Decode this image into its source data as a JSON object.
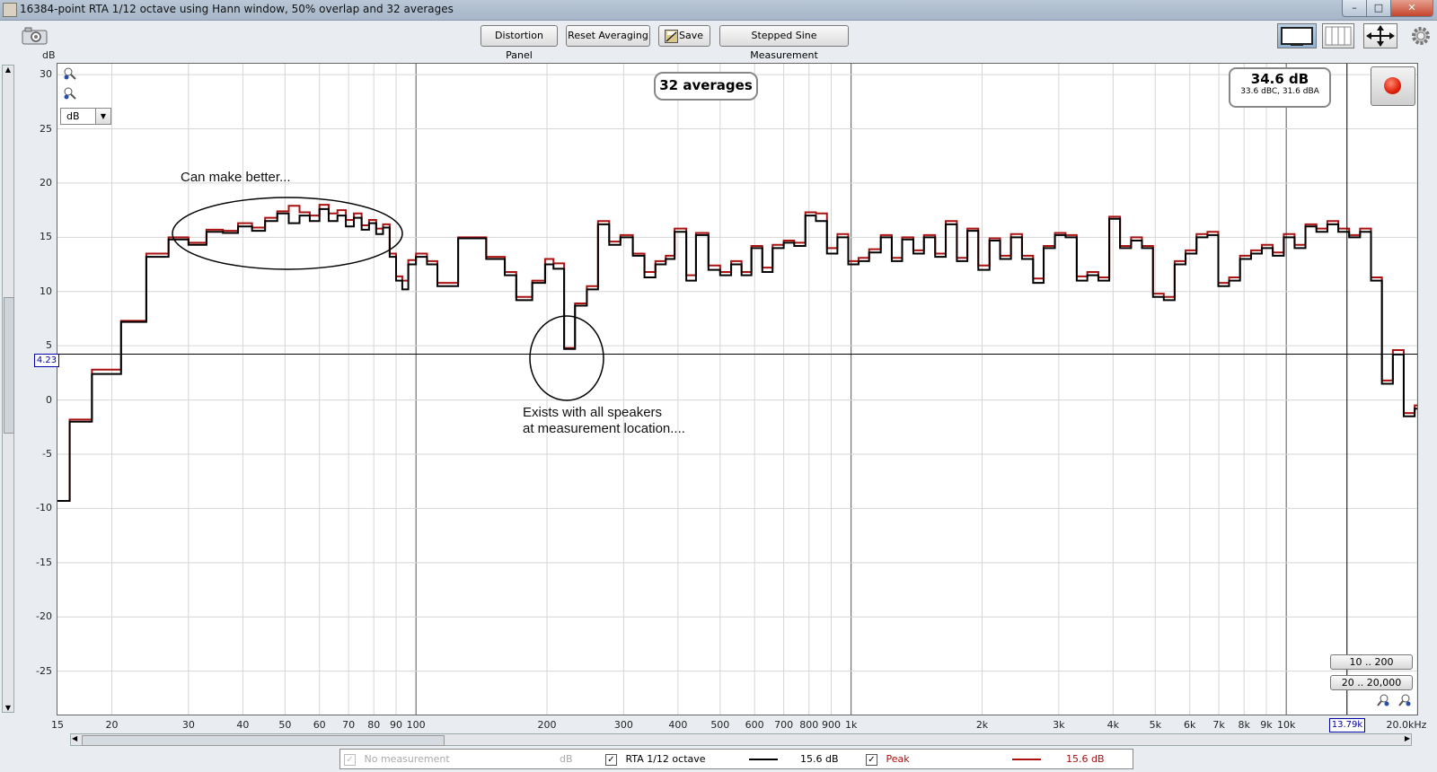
{
  "window": {
    "title": "16384-point RTA 1/12 octave using Hann window, 50% overlap and 32 averages",
    "minimize": "–",
    "maximize": "□",
    "close": "✕"
  },
  "toolbar": {
    "distortion_label": "Distortion Panel",
    "reset_label": "Reset Averaging",
    "save_label": "Save",
    "stepped_label": "Stepped Sine Measurement"
  },
  "plot": {
    "y_unit": "dB",
    "x_unit": "Hz",
    "y_ticks": [
      "30",
      "25",
      "20",
      "15",
      "10",
      "5",
      "0",
      "-5",
      "-10",
      "-15",
      "-20",
      "-25"
    ],
    "y_values": [
      30,
      25,
      20,
      15,
      10,
      5,
      0,
      -5,
      -10,
      -15,
      -20,
      -25
    ],
    "x_ticks": [
      {
        "label": "15",
        "f": 15
      },
      {
        "label": "20",
        "f": 20
      },
      {
        "label": "30",
        "f": 30
      },
      {
        "label": "40",
        "f": 40
      },
      {
        "label": "50",
        "f": 50
      },
      {
        "label": "60",
        "f": 60
      },
      {
        "label": "70",
        "f": 70
      },
      {
        "label": "80",
        "f": 80
      },
      {
        "label": "90",
        "f": 90
      },
      {
        "label": "100",
        "f": 100
      },
      {
        "label": "200",
        "f": 200
      },
      {
        "label": "300",
        "f": 300
      },
      {
        "label": "400",
        "f": 400
      },
      {
        "label": "500",
        "f": 500
      },
      {
        "label": "600",
        "f": 600
      },
      {
        "label": "700",
        "f": 700
      },
      {
        "label": "800",
        "f": 800
      },
      {
        "label": "900",
        "f": 900
      },
      {
        "label": "1k",
        "f": 1000
      },
      {
        "label": "2k",
        "f": 2000
      },
      {
        "label": "3k",
        "f": 3000
      },
      {
        "label": "4k",
        "f": 4000
      },
      {
        "label": "5k",
        "f": 5000
      },
      {
        "label": "6k",
        "f": 6000
      },
      {
        "label": "7k",
        "f": 7000
      },
      {
        "label": "8k",
        "f": 8000
      },
      {
        "label": "9k",
        "f": 9000
      },
      {
        "label": "10k",
        "f": 10000
      },
      {
        "label": "20.0kHz",
        "f": 20000
      }
    ],
    "cursor_y_label": "4.23",
    "cursor_x_label": "13.79k",
    "cursor_y_value": 4.23,
    "cursor_x_value": 13790,
    "unit_select": "dB",
    "averages_badge": "32 averages",
    "spl_main": "34.6 dB",
    "spl_sub": "33.6 dBC, 31.6 dBA",
    "range_btn_1": "10 .. 200",
    "range_btn_2": "20 .. 20,000",
    "annotation_1": "Can make better...",
    "annotation_2_line1": "Exists with all speakers",
    "annotation_2_line2": "at measurement location....",
    "colors": {
      "rta": "#000000",
      "peak": "#aa1111",
      "grid_major": "#9a9a9a",
      "grid_minor": "#d6d6d6",
      "cursor": "#000000"
    }
  },
  "chart_data": {
    "type": "line",
    "xlabel": "Hz",
    "ylabel": "dB",
    "x_scale": "log",
    "xlim": [
      15,
      20000
    ],
    "ylim": [
      -29,
      31
    ],
    "grid": true,
    "series": [
      {
        "name": "RTA 1/12 octave",
        "color": "#000000",
        "points": [
          [
            15,
            -9.3
          ],
          [
            16,
            -2
          ],
          [
            18,
            2.4
          ],
          [
            21,
            7.2
          ],
          [
            24,
            13.2
          ],
          [
            27,
            14.8
          ],
          [
            30,
            14.3
          ],
          [
            33,
            15.5
          ],
          [
            36,
            15.4
          ],
          [
            39,
            16.0
          ],
          [
            42,
            15.6
          ],
          [
            45,
            16.5
          ],
          [
            48,
            17.2
          ],
          [
            51,
            16.3
          ],
          [
            54,
            17.0
          ],
          [
            57,
            16.5
          ],
          [
            60,
            17.6
          ],
          [
            63,
            16.5
          ],
          [
            66,
            17.0
          ],
          [
            69,
            16.0
          ],
          [
            72,
            16.8
          ],
          [
            75,
            15.7
          ],
          [
            78,
            16.3
          ],
          [
            81,
            15.3
          ],
          [
            84,
            15.9
          ],
          [
            87,
            13.2
          ],
          [
            90,
            11.0
          ],
          [
            93,
            10.2
          ],
          [
            96,
            12.5
          ],
          [
            100,
            13.2
          ],
          [
            106,
            12.5
          ],
          [
            112,
            10.5
          ],
          [
            125,
            14.9
          ],
          [
            145,
            13.0
          ],
          [
            160,
            11.5
          ],
          [
            170,
            9.2
          ],
          [
            185,
            10.8
          ],
          [
            198,
            12.5
          ],
          [
            207,
            12.1
          ],
          [
            219,
            4.7
          ],
          [
            232,
            8.7
          ],
          [
            247,
            10.2
          ],
          [
            262,
            16.2
          ],
          [
            278,
            14.3
          ],
          [
            295,
            15.0
          ],
          [
            315,
            13.3
          ],
          [
            335,
            11.3
          ],
          [
            355,
            12.5
          ],
          [
            375,
            13.0
          ],
          [
            393,
            15.5
          ],
          [
            418,
            11.0
          ],
          [
            440,
            15.2
          ],
          [
            470,
            12.0
          ],
          [
            500,
            11.5
          ],
          [
            530,
            12.5
          ],
          [
            560,
            11.5
          ],
          [
            590,
            14.0
          ],
          [
            625,
            11.8
          ],
          [
            660,
            14.0
          ],
          [
            700,
            14.5
          ],
          [
            740,
            14.2
          ],
          [
            785,
            17.0
          ],
          [
            830,
            16.5
          ],
          [
            880,
            13.5
          ],
          [
            930,
            15.0
          ],
          [
            985,
            12.5
          ],
          [
            1040,
            12.8
          ],
          [
            1100,
            13.6
          ],
          [
            1170,
            15.0
          ],
          [
            1240,
            12.8
          ],
          [
            1310,
            14.8
          ],
          [
            1390,
            13.5
          ],
          [
            1470,
            15.0
          ],
          [
            1560,
            13.2
          ],
          [
            1650,
            16.2
          ],
          [
            1750,
            12.8
          ],
          [
            1850,
            15.6
          ],
          [
            1960,
            12.0
          ],
          [
            2080,
            14.7
          ],
          [
            2200,
            13.0
          ],
          [
            2330,
            15.0
          ],
          [
            2470,
            13.0
          ],
          [
            2620,
            10.8
          ],
          [
            2770,
            14.0
          ],
          [
            2940,
            15.2
          ],
          [
            3110,
            15.0
          ],
          [
            3300,
            11.0
          ],
          [
            3490,
            11.5
          ],
          [
            3700,
            11.0
          ],
          [
            3920,
            16.7
          ],
          [
            4150,
            14.0
          ],
          [
            4400,
            14.7
          ],
          [
            4660,
            14.0
          ],
          [
            4940,
            9.5
          ],
          [
            5230,
            9.2
          ],
          [
            5540,
            12.5
          ],
          [
            5870,
            13.5
          ],
          [
            6220,
            15.0
          ],
          [
            6590,
            15.2
          ],
          [
            6980,
            10.5
          ],
          [
            7390,
            11.0
          ],
          [
            7830,
            13.0
          ],
          [
            8300,
            13.5
          ],
          [
            8790,
            14.0
          ],
          [
            9310,
            13.3
          ],
          [
            9870,
            15.0
          ],
          [
            10450,
            14.0
          ],
          [
            11070,
            16.0
          ],
          [
            11730,
            15.5
          ],
          [
            12430,
            16.2
          ],
          [
            13170,
            15.5
          ],
          [
            13950,
            15.0
          ],
          [
            14780,
            15.5
          ],
          [
            15660,
            11.0
          ],
          [
            16590,
            1.5
          ],
          [
            17580,
            4.2
          ],
          [
            18620,
            -1.5
          ],
          [
            19730,
            -0.8
          ],
          [
            20900,
            -5.4
          ]
        ]
      },
      {
        "name": "Peak",
        "color": "#aa1111",
        "points": [
          [
            15,
            -9.3
          ],
          [
            16,
            -1.8
          ],
          [
            18,
            2.8
          ],
          [
            21,
            7.3
          ],
          [
            24,
            13.5
          ],
          [
            27,
            15.0
          ],
          [
            30,
            14.5
          ],
          [
            33,
            15.7
          ],
          [
            36,
            15.6
          ],
          [
            39,
            16.3
          ],
          [
            42,
            15.9
          ],
          [
            45,
            16.8
          ],
          [
            48,
            17.4
          ],
          [
            51,
            17.9
          ],
          [
            54,
            17.3
          ],
          [
            57,
            17.0
          ],
          [
            60,
            18.0
          ],
          [
            63,
            17.2
          ],
          [
            66,
            17.5
          ],
          [
            69,
            16.6
          ],
          [
            72,
            17.2
          ],
          [
            75,
            16.1
          ],
          [
            78,
            16.6
          ],
          [
            81,
            15.8
          ],
          [
            84,
            16.2
          ],
          [
            87,
            13.5
          ],
          [
            90,
            11.4
          ],
          [
            93,
            11.0
          ],
          [
            96,
            12.9
          ],
          [
            100,
            13.5
          ],
          [
            106,
            12.8
          ],
          [
            112,
            10.8
          ],
          [
            125,
            15.0
          ],
          [
            145,
            13.2
          ],
          [
            160,
            11.8
          ],
          [
            170,
            9.5
          ],
          [
            185,
            11.0
          ],
          [
            198,
            13.0
          ],
          [
            207,
            12.6
          ],
          [
            219,
            4.8
          ],
          [
            232,
            8.9
          ],
          [
            247,
            10.5
          ],
          [
            262,
            16.5
          ],
          [
            278,
            14.6
          ],
          [
            295,
            15.2
          ],
          [
            315,
            13.5
          ],
          [
            335,
            11.8
          ],
          [
            355,
            12.8
          ],
          [
            375,
            13.3
          ],
          [
            393,
            15.8
          ],
          [
            418,
            11.5
          ],
          [
            440,
            15.4
          ],
          [
            470,
            12.4
          ],
          [
            500,
            11.8
          ],
          [
            530,
            12.8
          ],
          [
            560,
            11.8
          ],
          [
            590,
            14.2
          ],
          [
            625,
            12.2
          ],
          [
            660,
            14.3
          ],
          [
            700,
            14.7
          ],
          [
            740,
            14.5
          ],
          [
            785,
            17.3
          ],
          [
            830,
            17.2
          ],
          [
            880,
            14.0
          ],
          [
            930,
            15.3
          ],
          [
            985,
            12.8
          ],
          [
            1040,
            13.1
          ],
          [
            1100,
            13.9
          ],
          [
            1170,
            15.2
          ],
          [
            1240,
            13.1
          ],
          [
            1310,
            15.0
          ],
          [
            1390,
            13.8
          ],
          [
            1470,
            15.2
          ],
          [
            1560,
            13.5
          ],
          [
            1650,
            16.5
          ],
          [
            1750,
            13.1
          ],
          [
            1850,
            15.8
          ],
          [
            1960,
            12.4
          ],
          [
            2080,
            14.9
          ],
          [
            2200,
            13.3
          ],
          [
            2330,
            15.3
          ],
          [
            2470,
            13.3
          ],
          [
            2620,
            11.2
          ],
          [
            2770,
            14.2
          ],
          [
            2940,
            15.4
          ],
          [
            3110,
            15.2
          ],
          [
            3300,
            11.4
          ],
          [
            3490,
            11.8
          ],
          [
            3700,
            11.3
          ],
          [
            3920,
            16.9
          ],
          [
            4150,
            14.2
          ],
          [
            4400,
            15.0
          ],
          [
            4660,
            14.2
          ],
          [
            4940,
            9.8
          ],
          [
            5230,
            9.5
          ],
          [
            5540,
            12.8
          ],
          [
            5870,
            13.8
          ],
          [
            6220,
            15.3
          ],
          [
            6590,
            15.5
          ],
          [
            6980,
            10.8
          ],
          [
            7390,
            11.3
          ],
          [
            7830,
            13.3
          ],
          [
            8300,
            13.8
          ],
          [
            8790,
            14.3
          ],
          [
            9310,
            13.6
          ],
          [
            9870,
            15.3
          ],
          [
            10450,
            14.3
          ],
          [
            11070,
            16.2
          ],
          [
            11730,
            15.8
          ],
          [
            12430,
            16.5
          ],
          [
            13170,
            15.8
          ],
          [
            13950,
            15.2
          ],
          [
            14780,
            15.8
          ],
          [
            15660,
            11.3
          ],
          [
            16590,
            1.8
          ],
          [
            17580,
            4.6
          ],
          [
            18620,
            -1.2
          ],
          [
            19730,
            -0.5
          ],
          [
            20900,
            -5.2
          ]
        ]
      }
    ]
  },
  "legend": {
    "no_measurement": "No measurement",
    "no_measurement_unit": "dB",
    "rta_label": "RTA 1/12 octave",
    "rta_value": "15.6 dB",
    "peak_label": "Peak",
    "peak_value": "15.6 dB",
    "check": "✓"
  }
}
